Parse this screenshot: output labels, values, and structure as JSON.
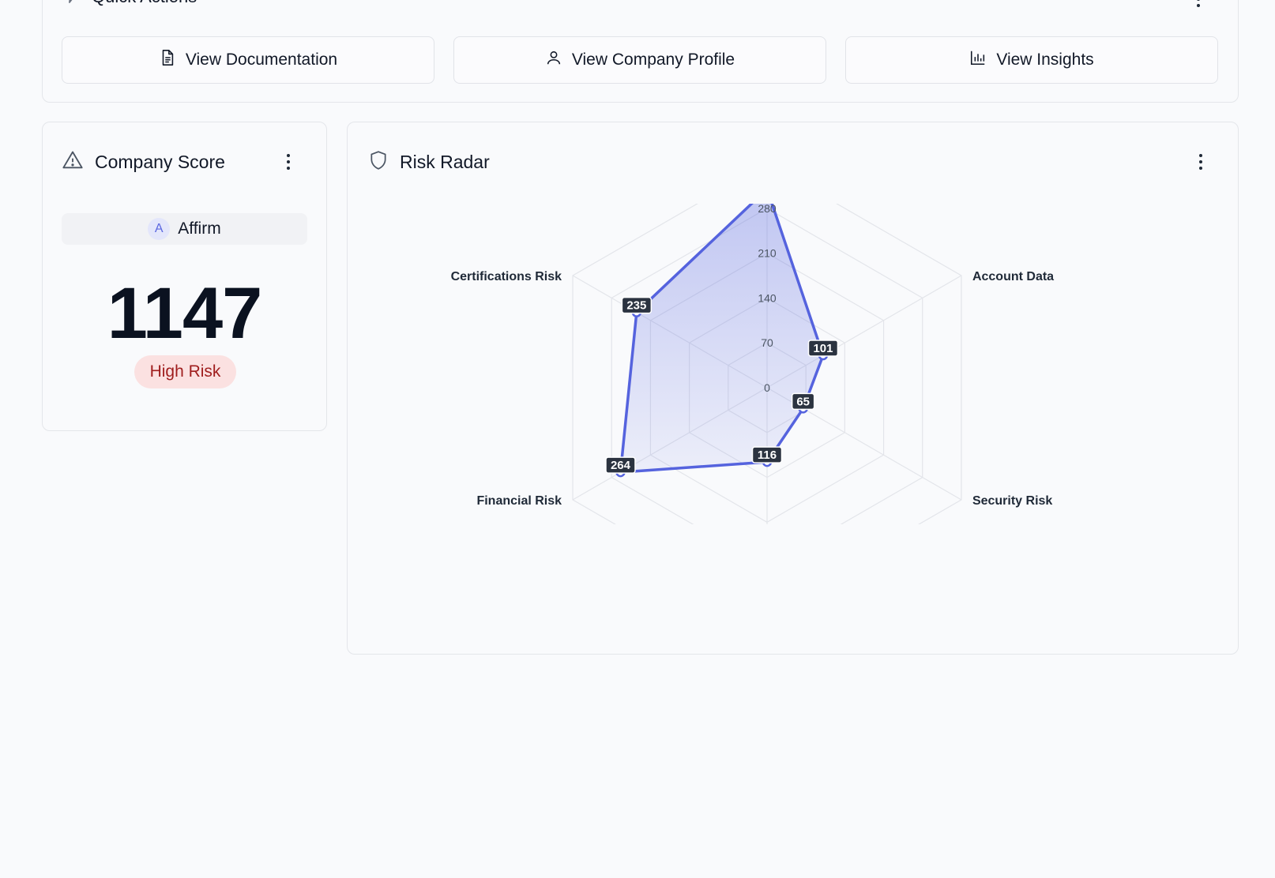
{
  "quick_actions": {
    "title": "Quick Actions",
    "buttons": [
      {
        "label": "View Documentation",
        "icon": "document-icon"
      },
      {
        "label": "View Company Profile",
        "icon": "user-icon"
      },
      {
        "label": "View Insights",
        "icon": "bar-chart-icon"
      }
    ]
  },
  "company_score": {
    "title": "Company Score",
    "company_initial": "A",
    "company_name": "Affirm",
    "score": "1147",
    "risk_level": "High Risk",
    "risk_color": "#9f1d1d",
    "risk_bg": "#fbe1e1"
  },
  "risk_radar": {
    "title": "Risk Radar",
    "accent": "#5563de"
  },
  "chart_data": {
    "type": "radar",
    "axes": [
      "",
      "Account Data",
      "Security Risk",
      "",
      "Financial Risk",
      "Certifications Risk"
    ],
    "values": [
      310,
      101,
      65,
      116,
      264,
      235
    ],
    "value_labels": [
      "",
      "101",
      "65",
      "116",
      "264",
      "235"
    ],
    "radial_ticks": [
      0,
      70,
      140,
      210,
      280
    ],
    "rmax": 350,
    "grid": true
  }
}
